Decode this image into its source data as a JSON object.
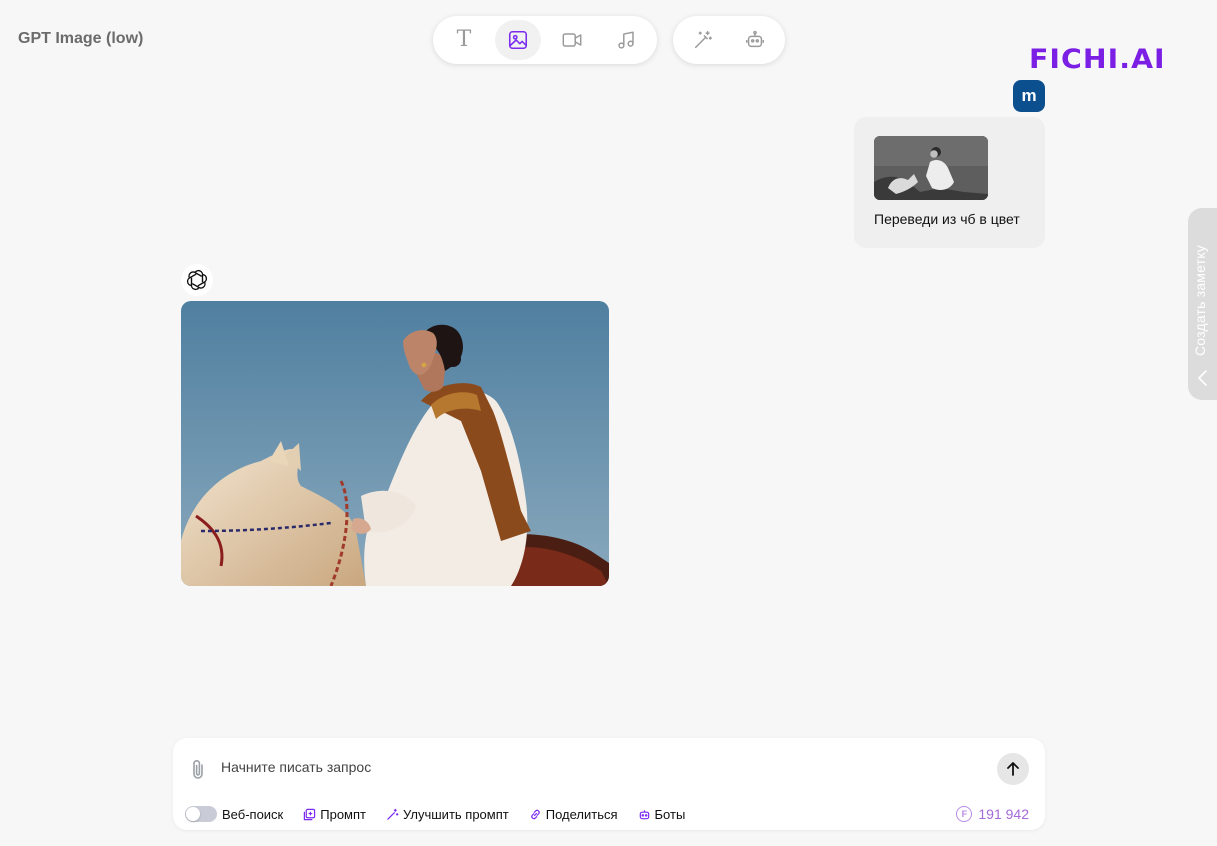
{
  "header": {
    "model_label": "GPT Image (low)",
    "brand": "FICHI.AI",
    "mode_buttons": [
      {
        "name": "text-mode",
        "icon": "text-icon",
        "active": false
      },
      {
        "name": "image-mode",
        "icon": "image-icon",
        "active": true
      },
      {
        "name": "video-mode",
        "icon": "video-icon",
        "active": false
      },
      {
        "name": "music-mode",
        "icon": "music-icon",
        "active": false
      },
      {
        "name": "magic-mode",
        "icon": "magic-wand-icon",
        "active": false
      },
      {
        "name": "bots-mode",
        "icon": "robot-icon",
        "active": false
      }
    ]
  },
  "chat": {
    "user": {
      "avatar_letter": "m",
      "avatar_color": "#0c4f8e",
      "message_text": "Переведи из чб в цвет",
      "attachment": "photo-bw-thumbnail"
    },
    "assistant": {
      "avatar_icon": "openai-icon",
      "image": "generated-color-photo"
    }
  },
  "side_tab": {
    "label": "Создать заметку"
  },
  "composer": {
    "placeholder": "Начните писать запрос",
    "web_search_label": "Веб-поиск",
    "web_search_enabled": false,
    "prompt_label": "Промпт",
    "improve_label": "Улучшить промпт",
    "share_label": "Поделиться",
    "bots_label": "Боты",
    "credits": "191 942"
  },
  "colors": {
    "accent": "#7b2bf0",
    "brand": "#7b1fe5",
    "background": "#f7f7f7"
  }
}
